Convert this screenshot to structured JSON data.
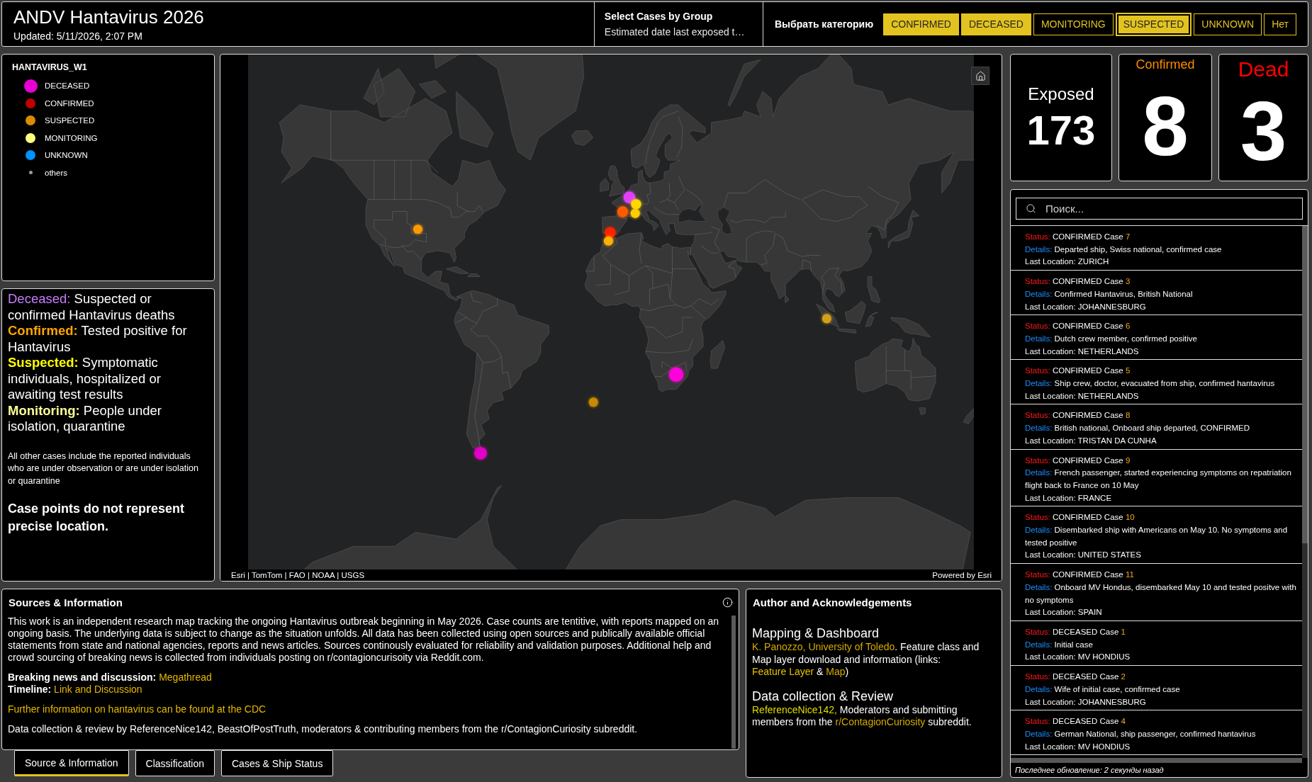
{
  "header": {
    "title": "ANDV Hantavirus 2026",
    "updated": "Updated: 5/11/2026, 2:07 PM"
  },
  "group_selector": {
    "title": "Select Cases by Group",
    "value": "Estimated date last exposed t…"
  },
  "category_filter": {
    "label": "Выбрать категорию",
    "options": [
      {
        "label": "CONFIRMED",
        "selected": true,
        "focused": false
      },
      {
        "label": "DECEASED",
        "selected": true,
        "focused": false
      },
      {
        "label": "MONITORING",
        "selected": false,
        "focused": false
      },
      {
        "label": "SUSPECTED",
        "selected": true,
        "focused": true
      },
      {
        "label": "UNKNOWN",
        "selected": false,
        "focused": false
      },
      {
        "label": "Нет",
        "selected": false,
        "focused": false
      }
    ]
  },
  "legend": {
    "title": "HANTAVIRUS_W1",
    "items": [
      {
        "label": "DECEASED",
        "color": "#e600d2",
        "kind": "large"
      },
      {
        "label": "CONFIRMED",
        "color": "#c00000",
        "kind": "medium"
      },
      {
        "label": "SUSPECTED",
        "color": "#d98c00",
        "kind": "medium"
      },
      {
        "label": "MONITORING",
        "color": "#ffff80",
        "kind": "medium"
      },
      {
        "label": "UNKNOWN",
        "color": "#0090ff",
        "kind": "medium"
      },
      {
        "label": "others",
        "color": "#9a9a9a",
        "kind": "small"
      }
    ]
  },
  "definitions": {
    "entries": [
      {
        "term": "Deceased:",
        "text": "Suspected or confirmed Hantavirus deaths",
        "color": "#c77dff",
        "bold": false
      },
      {
        "term": "Confirmed:",
        "text": "Tested positive for Hantavirus",
        "color": "#ffa500",
        "bold": true
      },
      {
        "term": "Suspected:",
        "text": "Symptomatic individuals, hospitalized or awaiting test results",
        "color": "#ffff00",
        "bold": true
      },
      {
        "term": "Monitoring:",
        "text": "People under isolation, quarantine",
        "color": "#ffff99",
        "bold": true
      }
    ],
    "note": "All other cases include the reported individuals who are under observation or are under isolation or quarantine",
    "warning": "Case points do not represent precise location."
  },
  "map": {
    "markers": [
      {
        "color": "#ff9900"
      },
      {
        "color": "#e040fb"
      },
      {
        "color": "#ff5a00"
      },
      {
        "color": "#ffd700"
      },
      {
        "color": "#ffcc00"
      },
      {
        "color": "#ff2200"
      },
      {
        "color": "#ffb000"
      },
      {
        "color": "#d4a017"
      },
      {
        "color": "#ff00dd"
      },
      {
        "color": "#c88a00"
      },
      {
        "color": "#e000c8"
      }
    ],
    "attribution": "Esri | TomTom | FAO | NOAA | USGS",
    "credit": "Powered by Esri"
  },
  "stats": [
    {
      "kind": "inline",
      "label": "Exposed",
      "value": "173",
      "color": "#ffffff"
    },
    {
      "kind": "caption",
      "label": "Confirmed",
      "value": "8",
      "color": "#ff8c00"
    },
    {
      "kind": "banner",
      "label": "Dead",
      "value": "3",
      "color": "#ff0000"
    }
  ],
  "case_list": {
    "search": {
      "placeholder": "Поиск..."
    },
    "cases": [
      {
        "status_label": "Status:",
        "status": "CONFIRMED Case",
        "number": "7",
        "details_label": "Details:",
        "details": "Departed ship, Swiss national, confirmed case",
        "location": "Last Location: ZURICH"
      },
      {
        "status_label": "Status:",
        "status": "CONFIRMED Case",
        "number": "3",
        "details_label": "Details:",
        "details": "Confirmed Hantavirus, British National",
        "location": "Last Location: JOHANNESBURG"
      },
      {
        "status_label": "Status:",
        "status": "CONFIRMED Case",
        "number": "6",
        "details_label": "Details:",
        "details": "Dutch crew member, confirmed positive",
        "location": "Last Location: NETHERLANDS"
      },
      {
        "status_label": "Status:",
        "status": "CONFIRMED Case",
        "number": "5",
        "details_label": "Details:",
        "details": "Ship crew, doctor, evacuated from ship, confirmed hantavirus",
        "location": "Last Location: NETHERLANDS"
      },
      {
        "status_label": "Status:",
        "status": "CONFIRMED Case",
        "number": "8",
        "details_label": "Details:",
        "details": "British national, Onboard ship departed, CONFIRMED",
        "location": "Last Location: TRISTAN DA CUNHA"
      },
      {
        "status_label": "Status:",
        "status": "CONFIRMED Case",
        "number": "9",
        "details_label": "Details:",
        "details": "French passenger, started experiencing symptoms on repatriation flight back to France on 10 May",
        "location": "Last Location: FRANCE"
      },
      {
        "status_label": "Status:",
        "status": "CONFIRMED Case",
        "number": "10",
        "details_label": "Details:",
        "details": "Disembarked ship with Americans on May 10. No symptoms and tested positive",
        "location": "Last Location: UNITED STATES"
      },
      {
        "status_label": "Status:",
        "status": "CONFIRMED Case",
        "number": "11",
        "details_label": "Details:",
        "details": "Onboard MV Hondus, disembarked May 10 and tested positve with no symptoms",
        "location": "Last Location: SPAIN"
      },
      {
        "status_label": "Status:",
        "status": "DECEASED Case",
        "number": "1",
        "details_label": "Details:",
        "details": "Initial case",
        "location": "Last Location: MV HONDIUS"
      },
      {
        "status_label": "Status:",
        "status": "DECEASED Case",
        "number": "2",
        "details_label": "Details:",
        "details": "Wife of initial case, confirmed case",
        "location": "Last Location: JOHANNESBURG"
      },
      {
        "status_label": "Status:",
        "status": "DECEASED Case",
        "number": "4",
        "details_label": "Details:",
        "details": "German National, ship passenger, confirmed hantavirus",
        "location": "Last Location: MV HONDIUS"
      }
    ],
    "footer": "Последнее обновление: 2 секунды назад"
  },
  "sources": {
    "title": "Sources & Information",
    "blocks": [
      {
        "lines": [
          {
            "segments": [
              {
                "kind": "text",
                "text": "This work is an independent research map tracking the ongoing Hantavirus outbreak beginning in May 2026. Case counts are tentitive, with reports mapped on an ongoing basis. The underlying data is subject to change as the situation unfolds. All data has been collected using open sources and publically available official statements from state and national agencies, reports and news articles. Sources continously evaluated for reliability and validation purposes. Additional help and crowd sourcing of breaking news is collected from individuals posting on r/contagioncurisoity via Reddit.com."
              }
            ]
          }
        ]
      },
      {
        "lines": [
          {
            "segments": [
              {
                "kind": "text",
                "text": "**Breaking news and discussion:** "
              },
              {
                "kind": "link",
                "text": "Megathread"
              }
            ]
          },
          {
            "segments": [
              {
                "kind": "text",
                "text": "**Timeline:** "
              },
              {
                "kind": "link",
                "text": "Link and Discussion"
              }
            ]
          }
        ]
      },
      {
        "lines": [
          {
            "segments": [
              {
                "kind": "link",
                "text": "Further information on hantavirus can be found at the CDC"
              }
            ]
          }
        ]
      },
      {
        "lines": [
          {
            "segments": [
              {
                "kind": "text",
                "text": "Data collection & review by ReferenceNice142, BeastOfPostTruth, moderators & contributing members from the r/ContagionCuriosity subreddit."
              }
            ]
          }
        ]
      }
    ],
    "tabs": [
      {
        "label": "Source & Information",
        "selected": true
      },
      {
        "label": "Classification",
        "selected": false
      },
      {
        "label": "Cases & Ship Status",
        "selected": false
      }
    ]
  },
  "author": {
    "title": "Author and Acknowledgements",
    "sections": [
      {
        "heading": "Mapping & Dashboard",
        "segments": [
          {
            "kind": "link",
            "text": "K. Panozzo, University of Toledo",
            "color": "#d4aa00"
          },
          {
            "kind": "text",
            "text": ". Feature class and Map layer download and information (links: "
          },
          {
            "kind": "link",
            "text": "Feature Layer",
            "color": "#e6c200"
          },
          {
            "kind": "text",
            "text": " & "
          },
          {
            "kind": "link",
            "text": "Map",
            "color": "#d4aa00"
          },
          {
            "kind": "text",
            "text": ")"
          }
        ]
      },
      {
        "heading": "Data collection & Review",
        "segments": [
          {
            "kind": "link",
            "text": "ReferenceNice142,",
            "color": "#dede00"
          },
          {
            "kind": "text",
            "text": " Moderators and submitting members from the "
          },
          {
            "kind": "link",
            "text": "r/ContagionCuriosity",
            "color": "#d4aa00"
          },
          {
            "kind": "text",
            "text": " subreddit."
          }
        ]
      }
    ]
  }
}
